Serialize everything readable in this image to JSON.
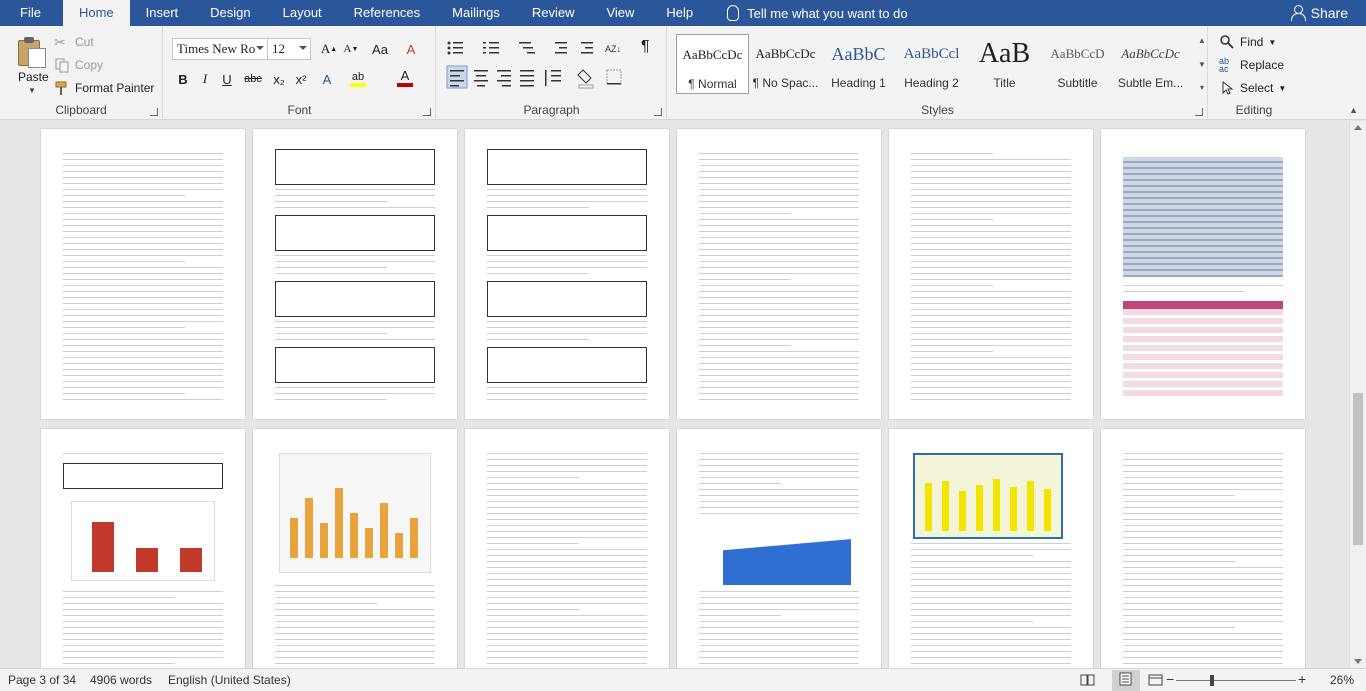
{
  "tabs": [
    "File",
    "Home",
    "Insert",
    "Design",
    "Layout",
    "References",
    "Mailings",
    "Review",
    "View",
    "Help"
  ],
  "active_tab": "Home",
  "tell_me": "Tell me what you want to do",
  "share": "Share",
  "clipboard": {
    "paste": "Paste",
    "cut": "Cut",
    "copy": "Copy",
    "format_painter": "Format Painter",
    "label": "Clipboard"
  },
  "font": {
    "name": "Times New Ro",
    "size": "12",
    "label": "Font",
    "bold": "B",
    "italic": "I",
    "underline": "U",
    "strike": "abc",
    "subscript": "x₂",
    "superscript": "x²",
    "grow": "A",
    "shrink": "A",
    "case": "Aa",
    "clear": "A",
    "effects": "A",
    "highlight": "ab",
    "color": "A",
    "accent_highlight": "#ffff00",
    "accent_color": "#c00000"
  },
  "paragraph": {
    "label": "Paragraph",
    "pilcrow": "¶"
  },
  "styles": {
    "label": "Styles",
    "items": [
      {
        "preview": "AaBbCcDc",
        "name": "¶ Normal"
      },
      {
        "preview": "AaBbCcDc",
        "name": "¶ No Spac..."
      },
      {
        "preview": "AaBbC",
        "name": "Heading 1"
      },
      {
        "preview": "AaBbCcl",
        "name": "Heading 2"
      },
      {
        "preview": "AaB",
        "name": "Title"
      },
      {
        "preview": "AaBbCcD",
        "name": "Subtitle"
      },
      {
        "preview": "AaBbCcDc",
        "name": "Subtle Em..."
      }
    ]
  },
  "editing": {
    "label": "Editing",
    "find": "Find",
    "replace": "Replace",
    "select": "Select"
  },
  "status": {
    "page": "Page 3 of 34",
    "words": "4906 words",
    "language": "English (United States)",
    "zoom": "26%",
    "zoom_level": 0.26
  },
  "colors": {
    "brand": "#2b579a",
    "ribbon": "#f3f3f3",
    "canvas": "#e6e6e6"
  }
}
